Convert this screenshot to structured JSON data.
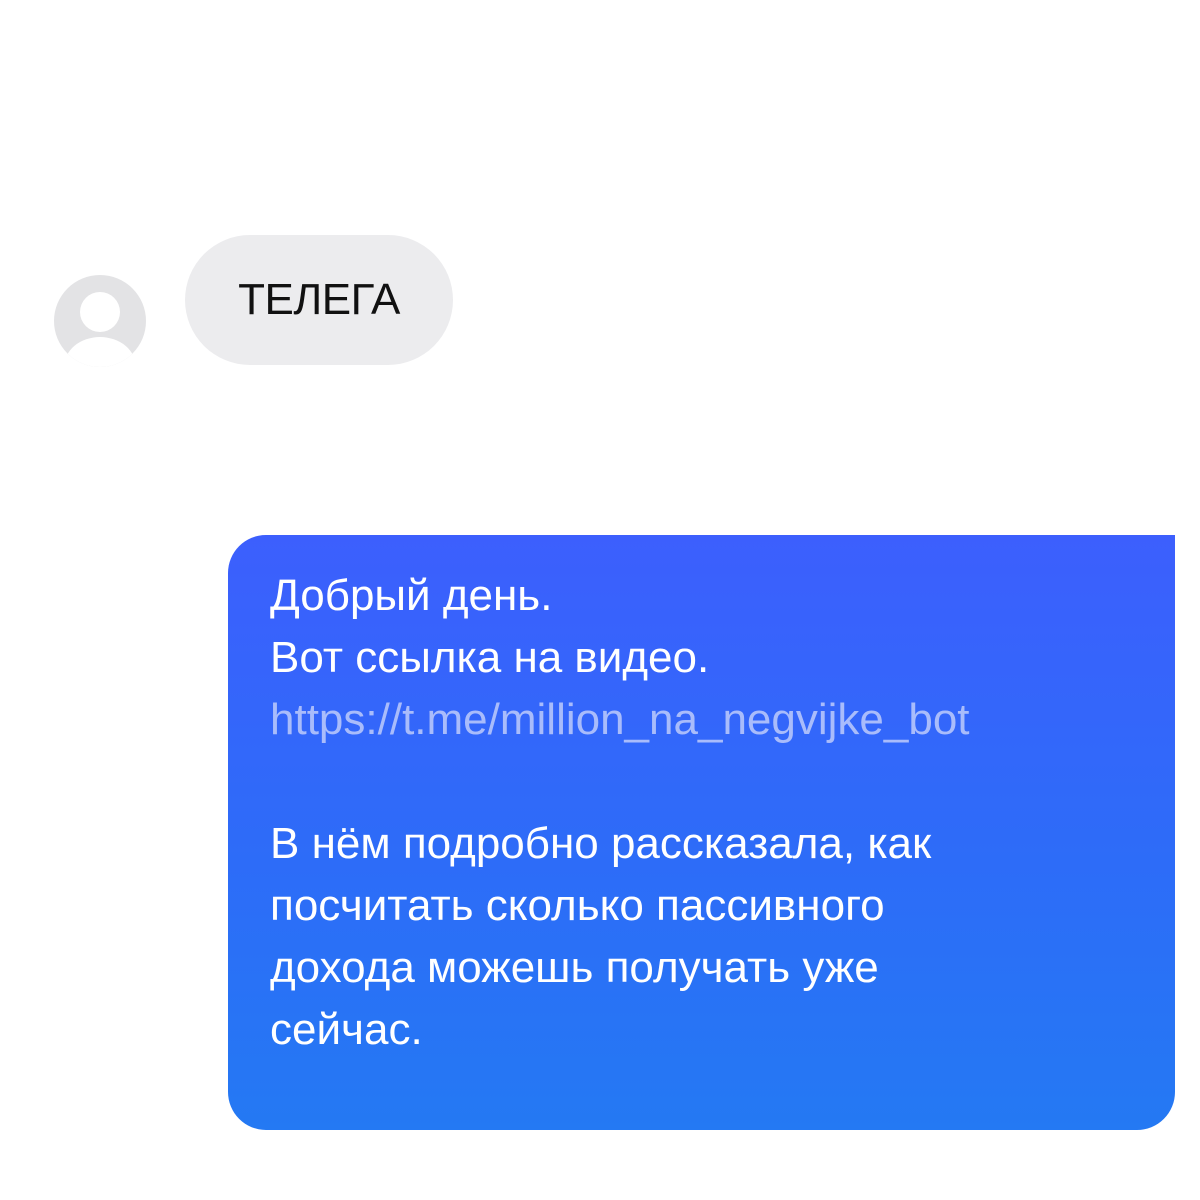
{
  "incoming_message": {
    "sender_avatar": "user-placeholder-icon",
    "text": "ТЕЛЕГА"
  },
  "outgoing_message": {
    "greeting": "Добрый день.",
    "intro": "Вот ссылка на видео.",
    "link": "https://t.me/million_na_negvijke_bot",
    "body_lines": [
      "В нём подробно рассказала, как",
      "посчитать сколько пассивного",
      "дохода можешь получать уже",
      "сейчас."
    ]
  },
  "colors": {
    "background": "#ffffff",
    "incoming_bubble": "#ececee",
    "outgoing_bubble": "#3265fb",
    "link_text": "#a9bcfb",
    "avatar_placeholder": "#e3e3e5"
  }
}
